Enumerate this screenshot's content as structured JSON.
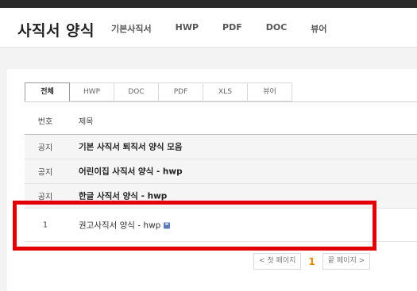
{
  "header": {
    "site_title": "사직서 양식",
    "nav": [
      "기본사직서",
      "HWP",
      "PDF",
      "DOC",
      "뷰어"
    ]
  },
  "tabs": [
    "전체",
    "HWP",
    "DOC",
    "PDF",
    "XLS",
    "뷰어"
  ],
  "active_tab": "전체",
  "list": {
    "columns": {
      "num": "번호",
      "title": "제목"
    },
    "notices": [
      {
        "num": "공지",
        "title": "기본 사직서 퇴직서 양식 모음"
      },
      {
        "num": "공지",
        "title": "어린이집 사직서 양식 - hwp"
      },
      {
        "num": "공지",
        "title": "한글 사직서 양식 - hwp"
      }
    ],
    "rows": [
      {
        "num": "1",
        "title": "권고사직서 양식 - hwp",
        "icon": "disk-icon"
      }
    ]
  },
  "pagination": {
    "first_label": "< 첫 페이지",
    "current": "1",
    "last_label": "끝 페이지 >"
  },
  "colors": {
    "highlight": "#e30000",
    "current_page": "#e08a00",
    "topbar": "#2b2b2b"
  }
}
